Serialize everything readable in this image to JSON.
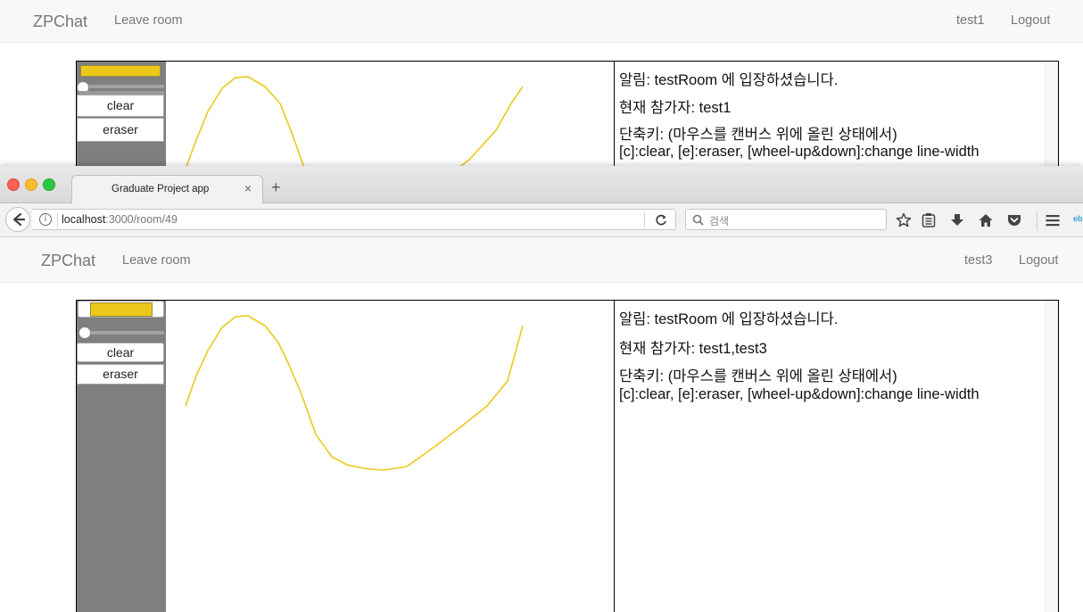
{
  "back_window": {
    "brand": "ZPChat",
    "leave_label": "Leave room",
    "username": "test1",
    "logout_label": "Logout",
    "tools": {
      "clear_label": "clear",
      "eraser_label": "eraser",
      "color": "#ecc81b"
    },
    "chat": {
      "notice": "알림: testRoom 에 입장하셨습니다.",
      "participants": "현재 참가자: test1",
      "shortcut_title": "단축키: (마우스를 캔버스 위에 올린 상태에서)",
      "shortcut_keys": "[c]:clear, [e]:eraser, [wheel-up&down]:change line-width"
    }
  },
  "browser": {
    "tab_title": "Graduate Project app",
    "url_host": "localhost",
    "url_path": ":3000/room/49",
    "search_placeholder": "검색",
    "toolbar_icons": [
      "back-icon",
      "info-icon",
      "reload-icon",
      "search-icon",
      "bookmark-star-icon",
      "reading-list-icon",
      "download-icon",
      "home-icon",
      "pocket-icon",
      "menu-icon"
    ]
  },
  "front_window": {
    "brand": "ZPChat",
    "leave_label": "Leave room",
    "username": "test3",
    "logout_label": "Logout",
    "tools": {
      "clear_label": "clear",
      "eraser_label": "eraser",
      "color": "#ecc81b"
    },
    "chat": {
      "notice": "알림: testRoom 에 입장하셨습니다.",
      "participants": "현재 참가자: test1,test3",
      "shortcut_title": "단축키: (마우스를 캔버스 위에 올린 상태에서)",
      "shortcut_keys": "[c]:clear, [e]:eraser, [wheel-up&down]:change line-width"
    }
  },
  "drawing": {
    "stroke_color": "#ecc81b"
  }
}
